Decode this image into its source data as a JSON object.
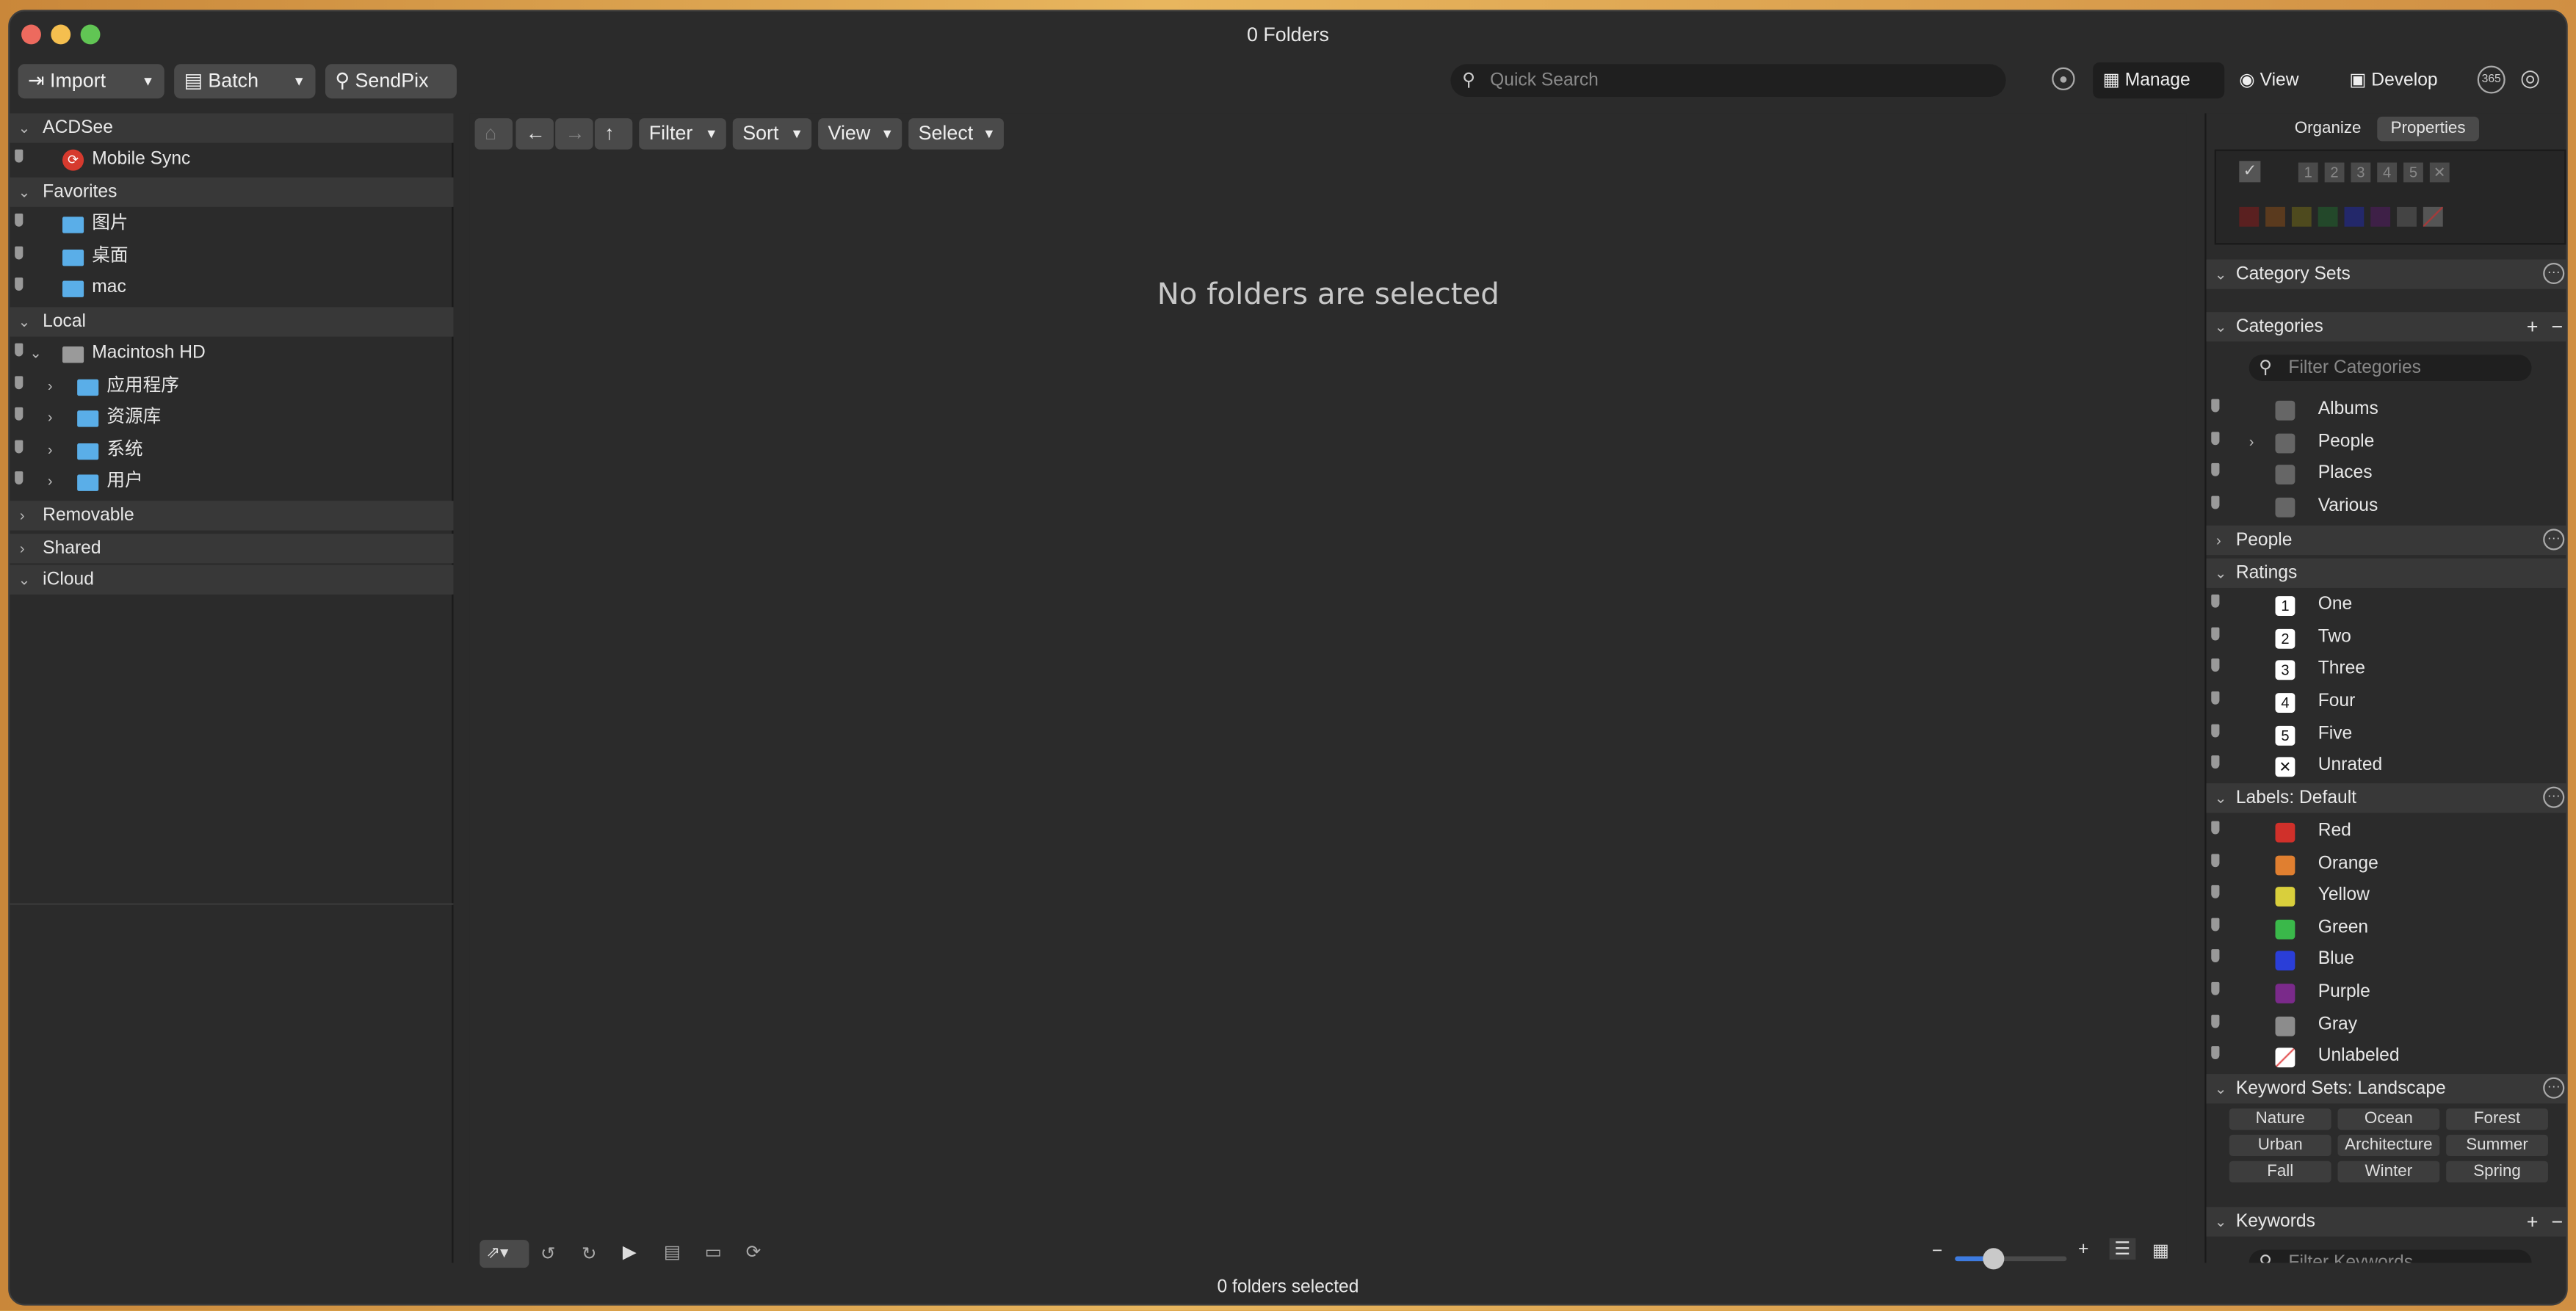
{
  "window": {
    "title": "0 Folders",
    "status": "0 folders selected"
  },
  "toolbar": {
    "import": "Import",
    "batch": "Batch",
    "sendpix": "SendPix",
    "search_placeholder": "Quick Search",
    "manage": "Manage",
    "view": "View",
    "develop": "Develop",
    "badge_365": "365"
  },
  "left": {
    "acdsee": "ACDSee",
    "mobile_sync": "Mobile Sync",
    "favorites": "Favorites",
    "fav_items": [
      "图片",
      "桌面",
      "mac"
    ],
    "local": "Local",
    "macintosh_hd": "Macintosh HD",
    "local_items": [
      "应用程序",
      "资源库",
      "系统",
      "用户"
    ],
    "removable": "Removable",
    "shared": "Shared",
    "icloud": "iCloud"
  },
  "browser": {
    "filter": "Filter",
    "sort": "Sort",
    "view": "View",
    "select": "Select",
    "empty_message": "No folders are selected"
  },
  "right": {
    "tab_organize": "Organize",
    "tab_properties": "Properties",
    "rating_digits": [
      "1",
      "2",
      "3",
      "4",
      "5"
    ],
    "category_sets": "Category Sets",
    "categories": "Categories",
    "filter_categories": "Filter Categories",
    "category_items": [
      "Albums",
      "People",
      "Places",
      "Various"
    ],
    "people": "People",
    "ratings": "Ratings",
    "rating_items": [
      {
        "n": "1",
        "label": "One"
      },
      {
        "n": "2",
        "label": "Two"
      },
      {
        "n": "3",
        "label": "Three"
      },
      {
        "n": "4",
        "label": "Four"
      },
      {
        "n": "5",
        "label": "Five"
      },
      {
        "n": "✕",
        "label": "Unrated"
      }
    ],
    "labels_title": "Labels: Default",
    "label_items": [
      {
        "label": "Red",
        "color": "#d0302a"
      },
      {
        "label": "Orange",
        "color": "#e07f30"
      },
      {
        "label": "Yellow",
        "color": "#d9cf3c"
      },
      {
        "label": "Green",
        "color": "#3ab84a"
      },
      {
        "label": "Blue",
        "color": "#2a3ed8"
      },
      {
        "label": "Purple",
        "color": "#7a2a8a"
      },
      {
        "label": "Gray",
        "color": "#8c8c8c"
      },
      {
        "label": "Unlabeled",
        "color": "#ffffff"
      }
    ],
    "keyword_sets": "Keyword Sets: Landscape",
    "keyword_buttons": [
      "Nature",
      "Ocean",
      "Forest",
      "Urban",
      "Architecture",
      "Summer",
      "Fall",
      "Winter",
      "Spring"
    ],
    "keywords": "Keywords",
    "filter_keywords": "Filter Keywords"
  }
}
